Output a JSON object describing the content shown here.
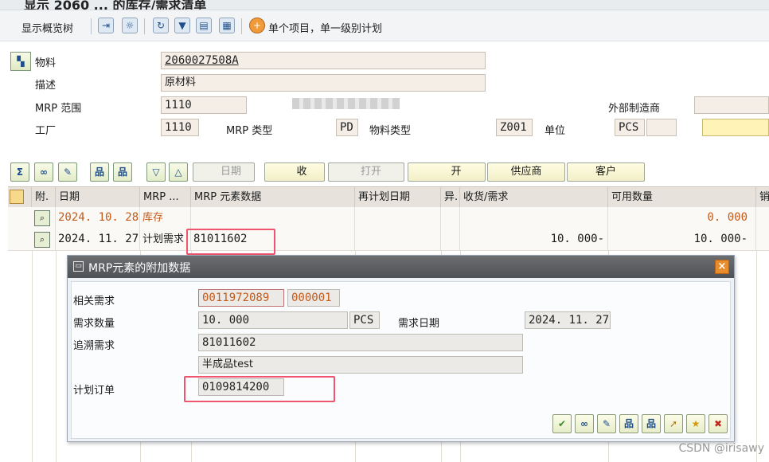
{
  "window_title": "显示 2060 ... 的库存/需求清单",
  "toolbar": {
    "overview_tree": "显示概览树",
    "single_item": "单个项目，单一级别计划"
  },
  "header": {
    "material_label": "物料",
    "material_value": "2060027508A",
    "desc_label": "描述",
    "desc_value": "原材料",
    "mrp_area_label": "MRP 范围",
    "mrp_area_value": "1110",
    "ext_mfg_label": "外部制造商",
    "plant_label": "工厂",
    "plant_value": "1110",
    "mrp_type_label": "MRP 类型",
    "mrp_type_value": "PD",
    "mat_type_label": "物料类型",
    "mat_type_value": "Z001",
    "unit_label": "单位",
    "unit_value": "PCS"
  },
  "buttons": {
    "date": "日期",
    "receipts": "收",
    "open": "打开",
    "open2": "开",
    "supplier": "供应商",
    "customer": "客户"
  },
  "grid": {
    "headers": [
      "附.",
      "日期",
      "MRP ...",
      "MRP 元素数据",
      "再计划日期",
      "异.",
      "收货/需求",
      "可用数量",
      "销"
    ],
    "rows": [
      {
        "date": "2024. 10. 28",
        "mrp": "库存",
        "data": "",
        "replan": "",
        "exc": "",
        "receipt": "",
        "avail": "0. 000"
      },
      {
        "date": "2024. 11. 27",
        "mrp": "计划需求",
        "data": "81011602",
        "replan": "",
        "exc": "",
        "receipt": "10. 000-",
        "avail": "10. 000-"
      }
    ]
  },
  "dialog": {
    "title": "MRP元素的附加数据",
    "related_label": "相关需求",
    "related_value": "0011972089",
    "related_item": "000001",
    "qty_label": "需求数量",
    "qty_value": "10. 000",
    "qty_unit": "PCS",
    "req_date_label": "需求日期",
    "req_date_value": "2024. 11. 27",
    "trace_label": "追溯需求",
    "trace_value": "81011602",
    "trace_text": "半成品test",
    "planned_label": "计划订单",
    "planned_value": "0109814200"
  },
  "watermark": "CSDN @irisawy"
}
